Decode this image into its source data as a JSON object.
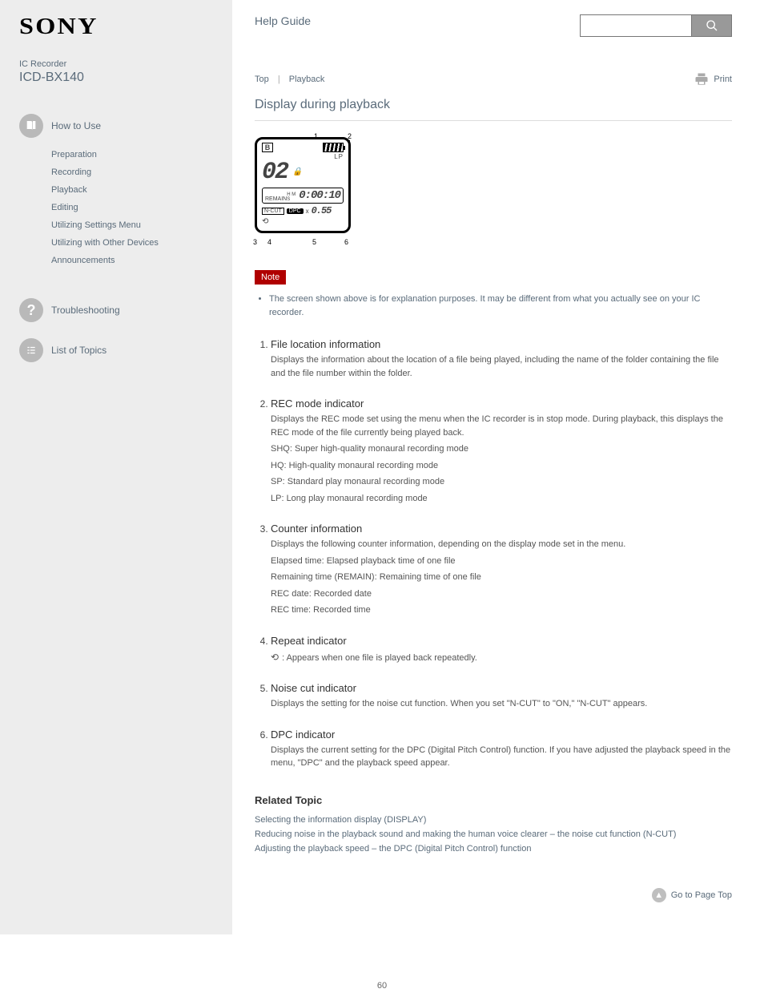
{
  "brand": "SONY",
  "product": {
    "device": "IC Recorder",
    "model": "ICD-BX140"
  },
  "guide_title": "Help Guide",
  "search": {
    "placeholder": "",
    "button_aria": "Search"
  },
  "print_label": "Print",
  "sidebar": {
    "how_to_use": {
      "title": "How to Use",
      "items": [
        "Preparation",
        "Recording",
        "Playback",
        "Editing",
        "Utilizing Settings Menu",
        "Utilizing with Other Devices",
        "Announcements"
      ]
    },
    "troubleshooting": {
      "title": "Troubleshooting"
    },
    "list_of_topics": {
      "title": "List of Topics"
    }
  },
  "breadcrumb": {
    "a": "Top",
    "b": "Playback"
  },
  "page_title": "Display during playback",
  "lcd": {
    "folder_letter": "B",
    "mode": "LP",
    "file_number": "02",
    "remain_label": "REMAIN",
    "hms": "H  M  S",
    "remain_digits": "0:00:10",
    "ncut": "N-CUT",
    "dpc": "DPC",
    "speed": "0.55",
    "callouts": {
      "1": "1",
      "2": "2",
      "3": "3",
      "4": "4",
      "5": "5",
      "6": "6"
    }
  },
  "note_label": "Note",
  "notes": [
    "The screen shown above is for explanation purposes. It may be different from what you actually see on your IC recorder."
  ],
  "items": [
    {
      "head": "File location information",
      "body": [
        "Displays the information about the location of a file being played, including the name of the folder containing the file and the file number within the folder."
      ]
    },
    {
      "head": "REC mode indicator",
      "body": [
        "Displays the REC mode set using the menu when the IC recorder is in stop mode. During playback, this displays the REC mode of the file currently being played back.",
        "SHQ: Super high-quality monaural recording mode",
        "HQ: High-quality monaural recording mode",
        "SP: Standard play monaural recording mode",
        "LP: Long play monaural recording mode"
      ]
    },
    {
      "head": "Counter information",
      "body": [
        "Displays the following counter information, depending on the display mode set in the menu.",
        "Elapsed time: Elapsed playback time of one file",
        "Remaining time (REMAIN): Remaining time of one file",
        "REC date: Recorded date",
        "REC time: Recorded time"
      ]
    },
    {
      "head": "Repeat indicator",
      "body_with_icon": {
        "icon": true,
        "text": ": Appears when one file is played back repeatedly."
      }
    },
    {
      "head": "Noise cut indicator",
      "body": [
        "Displays the setting for the noise cut function. When you set \"N-CUT\" to \"ON,\" \"N-CUT\" appears."
      ]
    },
    {
      "head": "DPC indicator",
      "body": [
        "Displays the current setting for the DPC (Digital Pitch Control) function. If you have adjusted the playback speed in the menu, \"DPC\" and the playback speed appear."
      ]
    }
  ],
  "related": {
    "title": "Related Topic",
    "links": [
      "Selecting the information display (DISPLAY)",
      "Reducing noise in the playback sound and making the human voice clearer – the noise cut function (N-CUT)",
      "Adjusting the playback speed – the DPC (Digital Pitch Control) function"
    ]
  },
  "go_top": "Go to Page Top",
  "page_number": "60"
}
